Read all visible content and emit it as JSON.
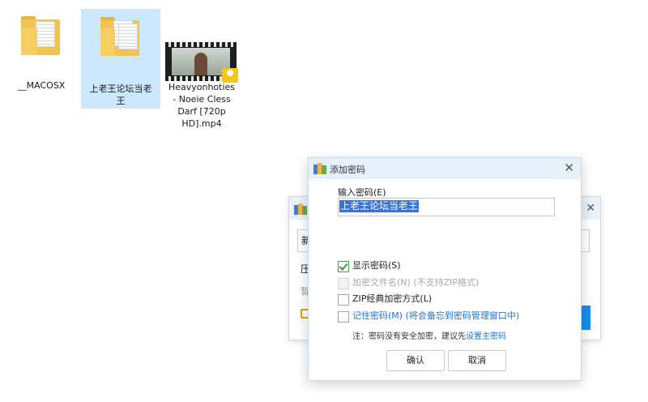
{
  "desktop": {
    "items": [
      {
        "label": "__MACOSX",
        "type": "folder"
      },
      {
        "label": "上老王论坛当老\n王",
        "type": "folder",
        "selected": true
      },
      {
        "label": "Heavyonhoties\n- Noeie Cless\nDarf [720p\nHD].mp4",
        "type": "video",
        "badge": "Player"
      }
    ]
  },
  "background_dialog": {
    "input_char": "新",
    "text1": "压",
    "text2": "暂"
  },
  "dialog": {
    "title": "添加密码",
    "close_glyph": "✕",
    "password_label": "输入密码(E)",
    "password_value": "上老王论坛当老王",
    "options": [
      {
        "label": "显示密码(S)",
        "checked": true,
        "disabled": false,
        "style": "normal"
      },
      {
        "label": "加密文件名(N) (不支持ZIP格式)",
        "checked": false,
        "disabled": true,
        "style": "normal"
      },
      {
        "label": "ZIP经典加密方式(L)",
        "checked": false,
        "disabled": false,
        "style": "normal"
      },
      {
        "label": "记住密码(M) (将会备忘到密码管理窗口中)",
        "checked": false,
        "disabled": false,
        "style": "link"
      }
    ],
    "note_prefix": "注：密码没有安全加密，建议先",
    "note_link": "设置主密码",
    "ok_label": "确认",
    "cancel_label": "取消"
  },
  "colors": {
    "selection": "#cce8ff",
    "title_bar": "#e6f0fb",
    "link": "#1a73d6",
    "check": "#2e9a3a",
    "highlight": "#3874d8"
  }
}
